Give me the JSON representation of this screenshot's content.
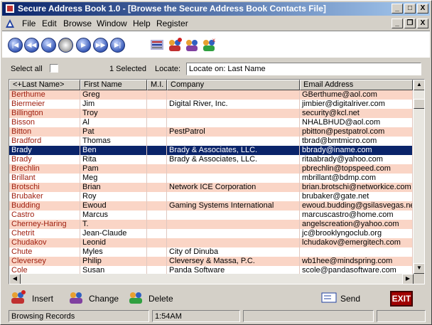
{
  "window": {
    "title": "Secure Address Book 1.0 - [Browse the Secure Address Book Contacts File]",
    "controls": [
      "_",
      "□",
      "X"
    ]
  },
  "menu": {
    "items": [
      "File",
      "Edit",
      "Browse",
      "Window",
      "Help",
      "Register"
    ],
    "doc_controls": [
      "_",
      "❐",
      "X"
    ]
  },
  "toolbar": {
    "nav_buttons": [
      "first-icon",
      "prev-page-icon",
      "prev-icon",
      "refresh-icon",
      "next-icon",
      "next-page-icon",
      "last-icon"
    ],
    "action_icons": [
      "browse-icon",
      "insert-icon",
      "change-icon",
      "delete-icon"
    ]
  },
  "selection": {
    "select_all_label": "Select all",
    "selected_text": "1 Selected",
    "locate_label": "Locate:",
    "locate_value": "Locate on: Last Name"
  },
  "table": {
    "columns": [
      "<+Last Name>",
      "First Name",
      "M.I.",
      "Company",
      "Email Address"
    ],
    "selected_index": 7,
    "rows": [
      [
        "Berthume",
        "Greg",
        "",
        "",
        "GBerthume@aol.com"
      ],
      [
        "Biermeier",
        "Jim",
        "",
        "Digital River, Inc.",
        "jimbier@digitalriver.com"
      ],
      [
        "Billington",
        "Troy",
        "",
        "",
        "security@kcl.net"
      ],
      [
        "Bisson",
        "Al",
        "",
        "",
        "NHALBHUD@aol.com"
      ],
      [
        "Bitton",
        "Pat",
        "",
        "PestPatrol",
        "pbitton@pestpatrol.com"
      ],
      [
        "Bradford",
        "Thomas",
        "",
        "",
        "tbrad@bmtmicro.com"
      ],
      [
        "Brady",
        "Ben",
        "",
        "Brady & Associates, LLC.",
        "bbrady@iname.com"
      ],
      [
        "Brady",
        "Rita",
        "",
        "Brady & Associates, LLC.",
        "ritaabrady@yahoo.com"
      ],
      [
        "Brechlin",
        "Pam",
        "",
        "",
        "pbrechlin@topspeed.com"
      ],
      [
        "Brillant",
        "Meg",
        "",
        "",
        "mbrillant@bdmp.com"
      ],
      [
        "Brotschi",
        "Brian",
        "",
        "Network ICE Corporation",
        "brian.brotschi@networkice.com"
      ],
      [
        "Brubaker",
        "Roy",
        "",
        "",
        "brubaker@gate.net"
      ],
      [
        "Budding",
        "Ewoud",
        "",
        "Gaming Systems International",
        "ewoud.budding@gsilasvegas.ne"
      ],
      [
        "Castro",
        "Marcus",
        "",
        "",
        "marcuscastro@home.com"
      ],
      [
        "Cherney-Haring",
        "T.",
        "",
        "",
        "angelscreation@yahoo.com"
      ],
      [
        "Chetrit",
        "Jean-Claude",
        "",
        "",
        "jc@brooklyngoclub.org"
      ],
      [
        "Chudakov",
        "Leonid",
        "",
        "",
        "lchudakov@emergitech.com"
      ],
      [
        "Chute",
        "Myles",
        "",
        "City of Dinuba",
        ""
      ],
      [
        "Cleversey",
        "Philip",
        "",
        "Cleversey & Massa, P.C.",
        "wb1hee@mindspring.com"
      ],
      [
        "Cole",
        "Susan",
        "",
        "Panda Software",
        "scole@pandasoftware.com"
      ]
    ]
  },
  "actions": {
    "insert": "Insert",
    "change": "Change",
    "delete": "Delete",
    "send": "Send",
    "exit": "EXIT"
  },
  "status": {
    "mode": "Browsing Records",
    "time": "1:54AM"
  }
}
